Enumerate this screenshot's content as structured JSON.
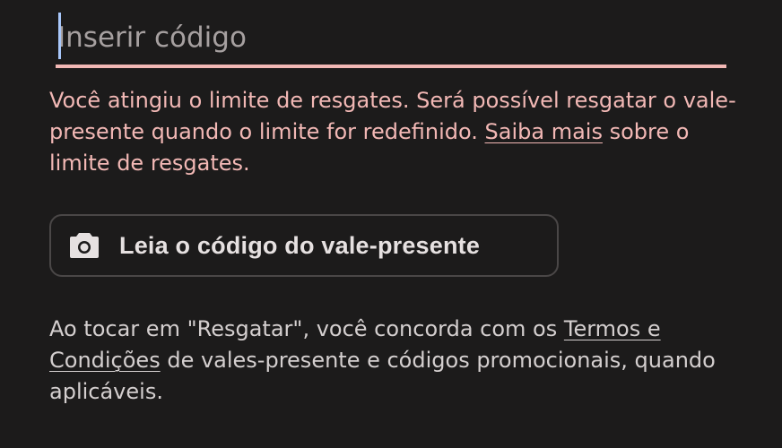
{
  "code_input": {
    "placeholder": "Inserir código",
    "value": ""
  },
  "error": {
    "text_before_link": "Você atingiu o limite de resgates. Será possível resgatar o vale-presente quando o limite for redefinido. ",
    "link_text": "Saiba mais",
    "text_after_link": " sobre o limite de resgates."
  },
  "scan_button": {
    "label": "Leia o código do vale-presente",
    "icon": "camera-icon"
  },
  "legal": {
    "text_before_link": "Ao tocar em \"Resgatar\", você concorda com os ",
    "link_text": "Termos e Condições",
    "text_after_link": " de vales-presente e códigos promocionais, quando aplicáveis."
  },
  "colors": {
    "background": "#1c1b1b",
    "error": "#f2b8b5",
    "cursor": "#a8c7fa",
    "text": "#e6e1e1"
  }
}
